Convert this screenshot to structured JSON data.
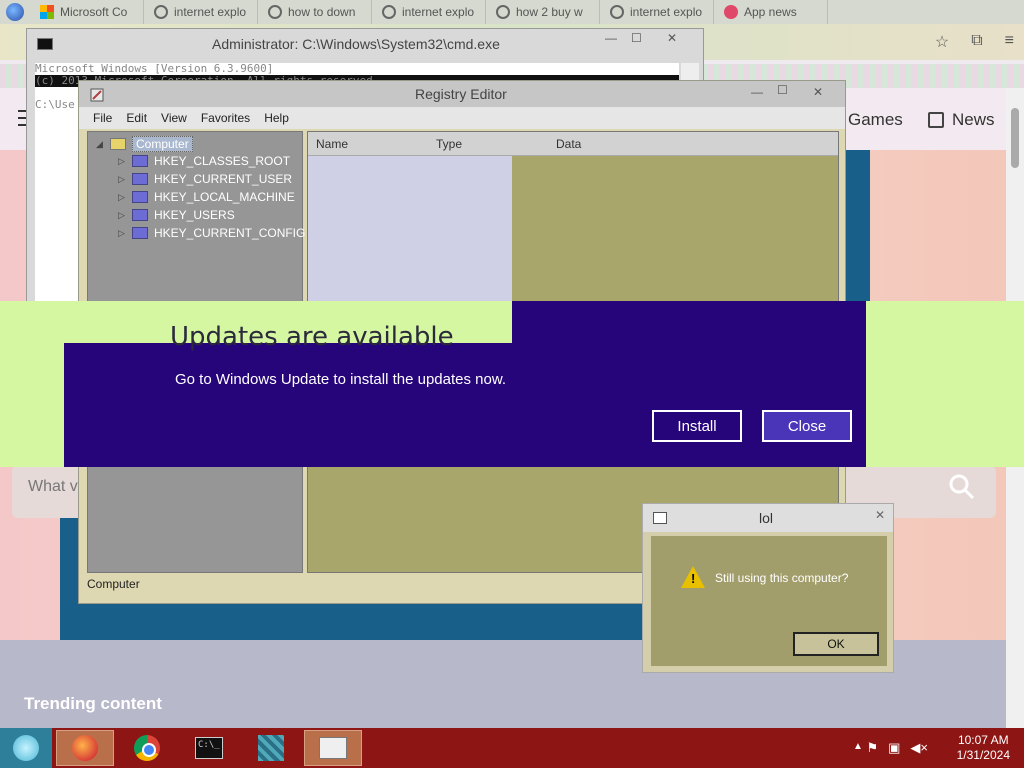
{
  "browser": {
    "tabs": [
      {
        "label": "Microsoft Co",
        "icon": "windows-logo-icon"
      },
      {
        "label": "internet explo",
        "icon": "google-icon"
      },
      {
        "label": "how to down",
        "icon": "google-icon"
      },
      {
        "label": "internet explo",
        "icon": "google-icon"
      },
      {
        "label": "how 2 buy w",
        "icon": "google-icon"
      },
      {
        "label": "internet explo",
        "icon": "google-icon"
      },
      {
        "label": "App news",
        "icon": "app-icon"
      }
    ],
    "toolbar_icons": [
      "star-icon",
      "extension-icon",
      "menu-icon"
    ],
    "nav": {
      "games": "Games",
      "news": "News"
    },
    "search_placeholder": "What v",
    "trending": "Trending content"
  },
  "cmd": {
    "title": "Administrator: C:\\Windows\\System32\\cmd.exe",
    "lines": [
      "Microsoft Windows [Version 6.3.9600]",
      "(c) 2013 Microsoft Corporation. All rights reserved.",
      "",
      "C:\\Use"
    ]
  },
  "regedit": {
    "title": "Registry Editor",
    "menu": [
      "File",
      "Edit",
      "View",
      "Favorites",
      "Help"
    ],
    "tree_root": "Computer",
    "hives": [
      "HKEY_CLASSES_ROOT",
      "HKEY_CURRENT_USER",
      "HKEY_LOCAL_MACHINE",
      "HKEY_USERS",
      "HKEY_CURRENT_CONFIG"
    ],
    "columns": [
      "Name",
      "Type",
      "Data"
    ],
    "status": "Computer"
  },
  "update": {
    "title": "Updates are available",
    "message": "Go to Windows Update to install the updates now.",
    "install_label": "Install",
    "close_label": "Close"
  },
  "lol_dialog": {
    "title": "lol",
    "message": "Still using this computer?",
    "ok_label": "OK",
    "close_glyph": "✕"
  },
  "taskbar": {
    "apps": [
      "firefox",
      "chrome",
      "cmd",
      "regedit",
      "explorer"
    ],
    "time": "10:07 AM",
    "date": "1/31/2024"
  },
  "window_controls": {
    "minimize": "—",
    "maximize": "☐",
    "close": "✕"
  }
}
